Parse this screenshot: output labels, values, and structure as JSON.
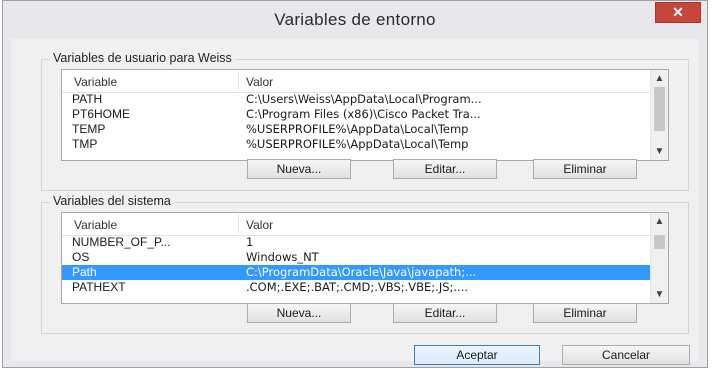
{
  "window": {
    "title": "Variables de entorno",
    "close_symbol": "✕"
  },
  "user_group": {
    "title": "Variables de usuario para Weiss",
    "columns": {
      "variable": "Variable",
      "value": "Valor"
    },
    "rows": [
      {
        "variable": "PATH",
        "value": "C:\\Users\\Weiss\\AppData\\Local\\Program...",
        "selected": false
      },
      {
        "variable": "PT6HOME",
        "value": "C:\\Program Files (x86)\\Cisco Packet Tra...",
        "selected": false
      },
      {
        "variable": "TEMP",
        "value": "%USERPROFILE%\\AppData\\Local\\Temp",
        "selected": false
      },
      {
        "variable": "TMP",
        "value": "%USERPROFILE%\\AppData\\Local\\Temp",
        "selected": false
      }
    ],
    "buttons": {
      "new": "Nueva...",
      "edit": "Editar...",
      "delete": "Eliminar"
    }
  },
  "system_group": {
    "title": "Variables del sistema",
    "columns": {
      "variable": "Variable",
      "value": "Valor"
    },
    "rows": [
      {
        "variable": "NUMBER_OF_P...",
        "value": "1",
        "selected": false
      },
      {
        "variable": "OS",
        "value": "Windows_NT",
        "selected": false
      },
      {
        "variable": "Path",
        "value": "C:\\ProgramData\\Oracle\\Java\\javapath;...",
        "selected": true
      },
      {
        "variable": "PATHEXT",
        "value": ".COM;.EXE;.BAT;.CMD;.VBS;.VBE;.JS;....",
        "selected": false
      }
    ],
    "buttons": {
      "new": "Nueva...",
      "edit": "Editar...",
      "delete": "Eliminar"
    }
  },
  "footer": {
    "accept": "Aceptar",
    "cancel": "Cancelar"
  },
  "colors": {
    "selection": "#3399ff",
    "close_button": "#c7463c"
  },
  "icons": {
    "scroll_up": "chevron-up-icon",
    "scroll_down": "chevron-down-icon",
    "close": "close-icon"
  }
}
